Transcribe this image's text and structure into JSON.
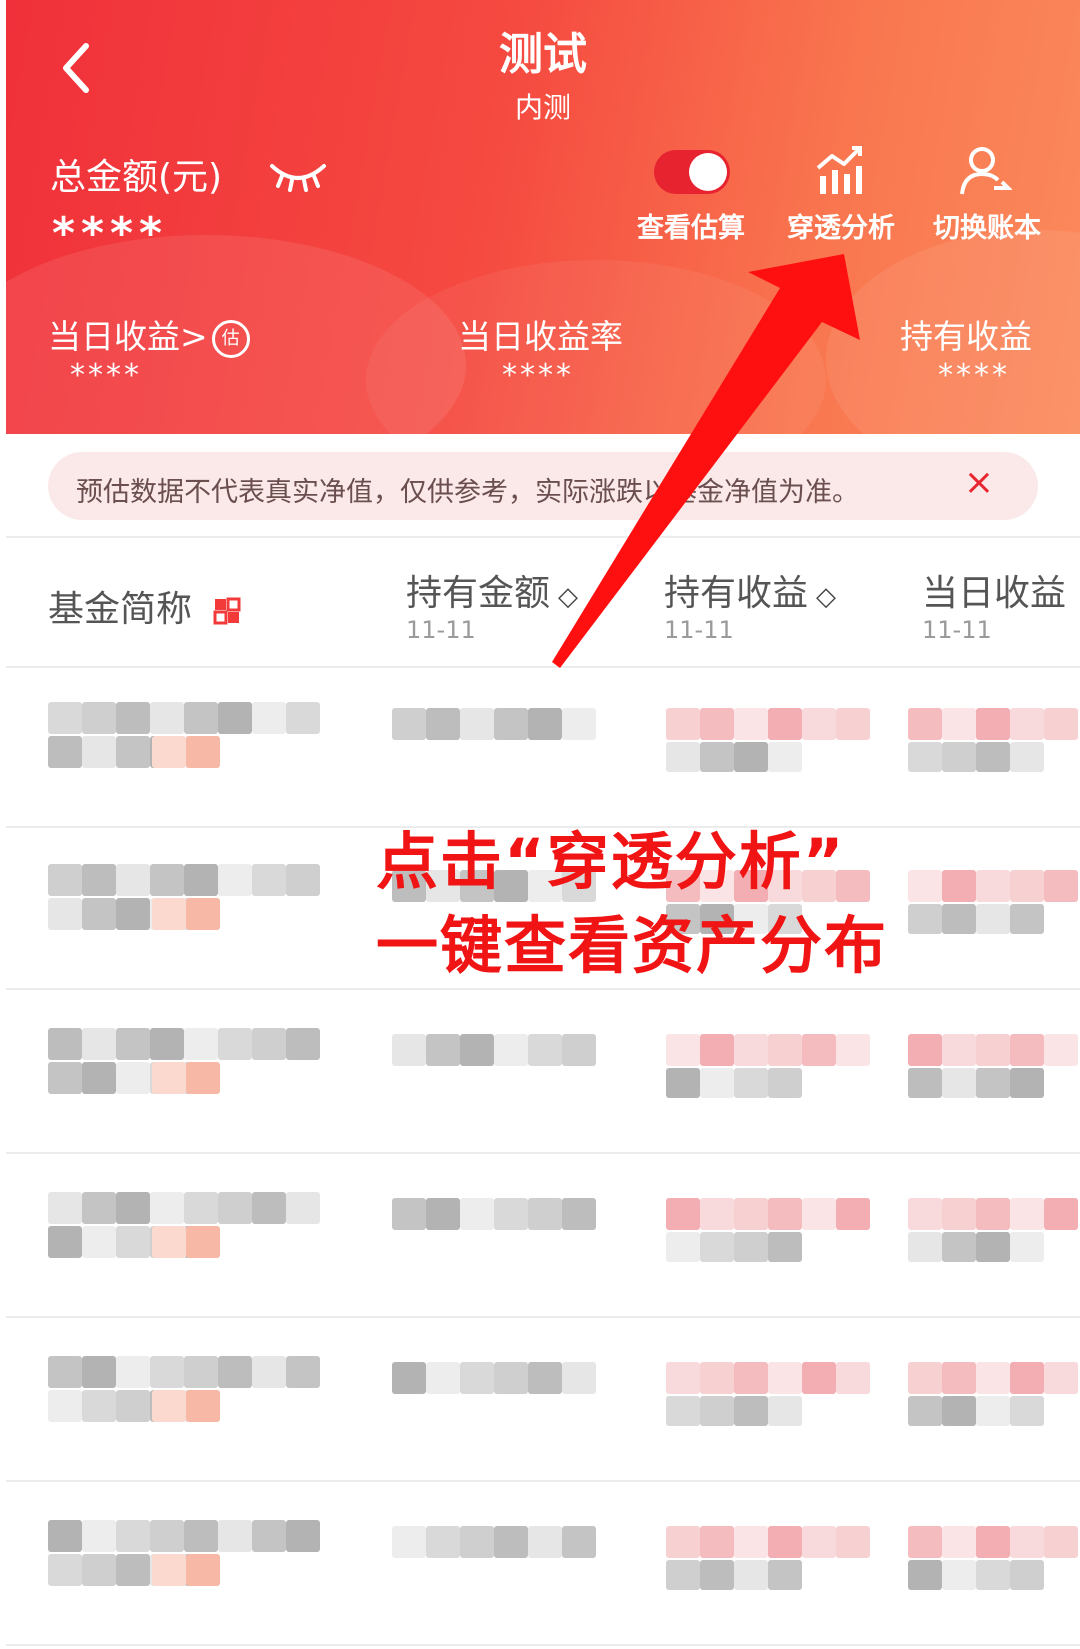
{
  "header": {
    "title": "测试",
    "subtitle": "内测",
    "total_label": "总金额(元)",
    "total_value": "****",
    "tools": [
      {
        "label": "查看估算",
        "icon": "toggle-switch-icon"
      },
      {
        "label": "穿透分析",
        "icon": "analysis-chart-icon"
      },
      {
        "label": "切换账本",
        "icon": "switch-user-icon"
      }
    ],
    "stats": [
      {
        "label": "当日收益",
        "value": "****"
      },
      {
        "label": "当日收益率",
        "value": "****"
      },
      {
        "label": "持有收益",
        "value": "****"
      }
    ],
    "stat_arrow": ">"
  },
  "notice": {
    "text": "预估数据不代表真实净值，仅供参考，实际涨跌以基金净值为准。",
    "close": "×"
  },
  "table": {
    "columns": [
      {
        "label": "基金简称",
        "sub": ""
      },
      {
        "label": "持有金额",
        "sub": "11-11"
      },
      {
        "label": "持有收益",
        "sub": "11-11"
      },
      {
        "label": "当日收益",
        "sub": "11-11"
      }
    ],
    "sort_icon": "◇"
  },
  "callout": {
    "line1": "点击“穿透分析”",
    "line2": "一键查看资产分布"
  },
  "colors": {
    "accent": "#f0303a",
    "callout": "#f01414"
  }
}
